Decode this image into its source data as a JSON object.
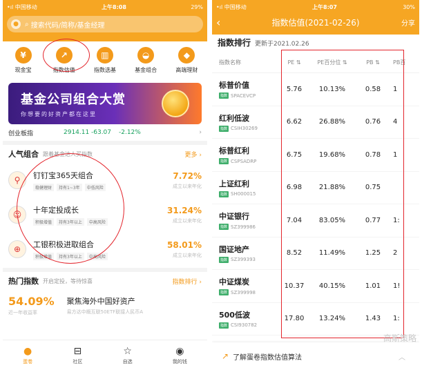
{
  "left": {
    "status": {
      "carrier": "•ıl 中国移动",
      "time": "上午8:08",
      "battery": "29%"
    },
    "search_placeholder": "搜索代码/简称/基金经理",
    "quick": [
      {
        "icon": "yen-icon",
        "glyph": "¥",
        "label": "现金宝"
      },
      {
        "icon": "chart-trend-icon",
        "glyph": "↗",
        "label": "指数估值"
      },
      {
        "icon": "bar-chart-icon",
        "glyph": "▥",
        "label": "指数选基"
      },
      {
        "icon": "portfolio-icon",
        "glyph": "◒",
        "label": "基金组合"
      },
      {
        "icon": "diamond-icon",
        "glyph": "◆",
        "label": "高端理财"
      }
    ],
    "banner": {
      "title": "基金公司组合大赏",
      "subtitle": "你想要的好资产都在这里"
    },
    "ticker": {
      "name": "创业板指",
      "value": "2914.11",
      "change": "-63.07",
      "pct": "-2.12%",
      "arrow": "›"
    },
    "popular": {
      "title": "人气组合",
      "subtitle": "跟着基金达人买指数",
      "more": "更多 ›"
    },
    "combos": [
      {
        "icon": "nail-icon",
        "glyph": "⚲",
        "name": "钉钉宝365天组合",
        "tags": [
          "稳健理财",
          "持有1~3年",
          "中低风险"
        ],
        "value": "7.72%",
        "label": "成立以来年化"
      },
      {
        "icon": "avatar-icon",
        "glyph": "☺",
        "name": "十年定投成长",
        "tags": [
          "积极增值",
          "持有3年以上",
          "中高风险"
        ],
        "value": "31.24%",
        "label": "成立以来年化"
      },
      {
        "icon": "bank-logo-icon",
        "glyph": "⊕",
        "name": "工银积极进取组合",
        "tags": [
          "积极增值",
          "持有3年以上",
          "中高风险"
        ],
        "value": "58.01%",
        "label": "成立以来年化"
      }
    ],
    "hot": {
      "title": "热门指数",
      "subtitle": "开启定投，等待惊喜",
      "more": "指数排行 ›",
      "pct": "54.09%",
      "pct_label": "近一年收益率",
      "name": "聚焦海外中国好资产",
      "desc": "易方达中概互联50ETF联接人民币A"
    },
    "tabs": [
      {
        "icon": "egg-icon",
        "glyph": "●",
        "label": "蛋卷"
      },
      {
        "icon": "community-icon",
        "glyph": "⊟",
        "label": "社区"
      },
      {
        "icon": "star-icon",
        "glyph": "☆",
        "label": "自选"
      },
      {
        "icon": "profile-icon",
        "glyph": "◉",
        "label": "我的钱"
      }
    ]
  },
  "right": {
    "status": {
      "carrier": "•ıl 中国移动",
      "time": "上午8:07",
      "battery": "30%"
    },
    "nav": {
      "back": "‹",
      "title": "指数估值(2021-02-26)",
      "share": "分享"
    },
    "heading": "指数排行",
    "updated": "更新于2021.02.26",
    "columns": [
      "指数名称",
      "PE ⇅",
      "PE百分位 ⇅",
      "PB ⇅",
      "PB百"
    ],
    "badge": "指数",
    "rows": [
      {
        "name": "标普价值",
        "code": "SPACEVCP",
        "pe": "5.76",
        "pe_pct": "10.13%",
        "pb": "0.58",
        "pb_pct": "1"
      },
      {
        "name": "红利低波",
        "code": "CSIH30269",
        "pe": "6.62",
        "pe_pct": "26.88%",
        "pb": "0.76",
        "pb_pct": "4"
      },
      {
        "name": "标普红利",
        "code": "CSPSADRP",
        "pe": "6.75",
        "pe_pct": "19.68%",
        "pb": "0.78",
        "pb_pct": "1"
      },
      {
        "name": "上证红利",
        "code": "SH000015",
        "pe": "6.98",
        "pe_pct": "21.88%",
        "pb": "0.75",
        "pb_pct": ""
      },
      {
        "name": "中证银行",
        "code": "SZ399986",
        "pe": "7.04",
        "pe_pct": "83.05%",
        "pb": "0.77",
        "pb_pct": "1:"
      },
      {
        "name": "国证地产",
        "code": "SZ399393",
        "pe": "8.52",
        "pe_pct": "11.49%",
        "pb": "1.25",
        "pb_pct": "2"
      },
      {
        "name": "中证煤炭",
        "code": "SZ399998",
        "pe": "10.37",
        "pe_pct": "40.15%",
        "pb": "1.01",
        "pb_pct": "1!"
      },
      {
        "name": "500低波",
        "code": "CSI930782",
        "pe": "17.80",
        "pe_pct": "13.24%",
        "pb": "1.43",
        "pb_pct": "1:"
      }
    ],
    "footer": {
      "icon": "arrow-trend-icon",
      "glyph": "↗",
      "text": "了解蛋卷指数估值算法",
      "chevron": "︿"
    },
    "watermark": "高斯策略"
  }
}
